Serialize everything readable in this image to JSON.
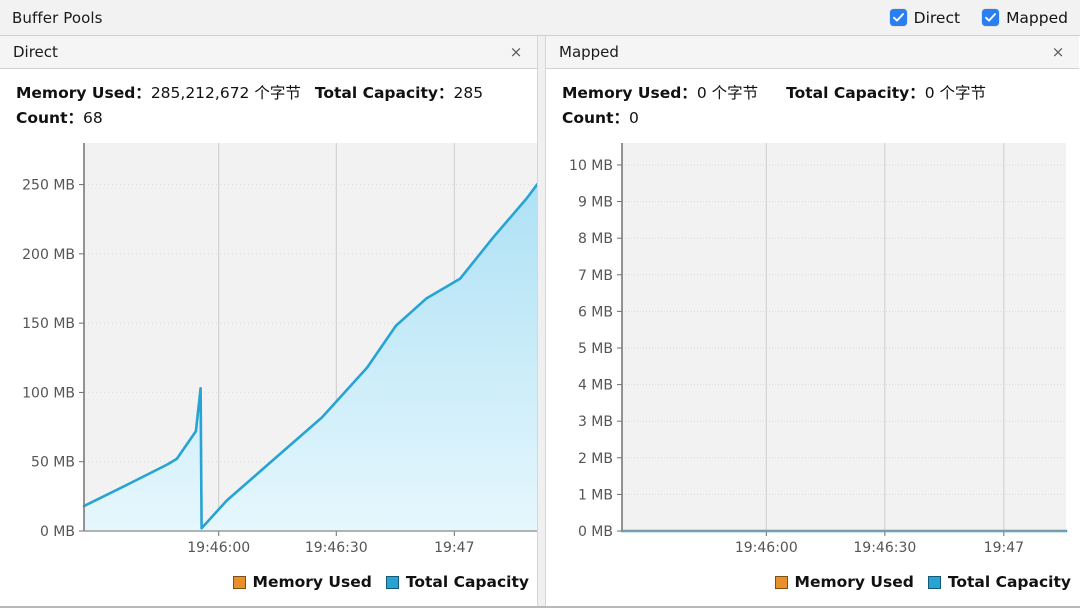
{
  "titlebar": {
    "label": "Buffer Pools",
    "checkboxes": [
      {
        "label": "Direct",
        "checked": true,
        "icon": "check-icon"
      },
      {
        "label": "Mapped",
        "checked": true,
        "icon": "check-icon"
      }
    ]
  },
  "colors": {
    "accent_blue": "#2a7ff0",
    "series_total_capacity": "#27a3d4",
    "series_memory_used": "#e8912a",
    "plot_bg": "#f2f2f2",
    "grid": "#d8d8d8",
    "axis": "#6d6d6d",
    "area_fill_top": "#a9dff4",
    "area_fill_bottom": "#e6f7fd"
  },
  "panels": [
    {
      "id": "direct",
      "title": "Direct",
      "close_label": "×",
      "stats": {
        "memory_used_label": "Memory Used：",
        "memory_used_value": "285,212,672 个字节",
        "total_capacity_label": "Total Capacity：",
        "total_capacity_value": "285",
        "count_label": "Count：",
        "count_value": "68"
      },
      "legend": [
        {
          "label": "Memory Used",
          "color": "#e8912a"
        },
        {
          "label": "Total Capacity",
          "color": "#27a3d4"
        }
      ],
      "chart_data": {
        "type": "area",
        "title": "Direct",
        "xlabel": "",
        "ylabel": "",
        "grid": true,
        "legend_position": "bottom-right",
        "x_ticks": [
          "19:46:00",
          "19:46:30",
          "19:47"
        ],
        "y_ticks": [
          "0 MB",
          "50 MB",
          "100 MB",
          "150 MB",
          "200 MB",
          "250 MB"
        ],
        "ylim": [
          0,
          280
        ],
        "y_tick_values": [
          0,
          50,
          100,
          150,
          200,
          250
        ],
        "series": [
          {
            "name": "Total Capacity",
            "color": "#27a3d4",
            "unit": "MB",
            "points": [
              {
                "t": 0.0,
                "v": 18
              },
              {
                "t": 0.1,
                "v": 35
              },
              {
                "t": 0.175,
                "v": 48
              },
              {
                "t": 0.195,
                "v": 52
              },
              {
                "t": 0.235,
                "v": 72
              },
              {
                "t": 0.245,
                "v": 103
              },
              {
                "t": 0.247,
                "v": 2
              },
              {
                "t": 0.3,
                "v": 22
              },
              {
                "t": 0.4,
                "v": 52
              },
              {
                "t": 0.5,
                "v": 82
              },
              {
                "t": 0.595,
                "v": 118
              },
              {
                "t": 0.655,
                "v": 148
              },
              {
                "t": 0.72,
                "v": 168
              },
              {
                "t": 0.79,
                "v": 182
              },
              {
                "t": 0.86,
                "v": 212
              },
              {
                "t": 0.93,
                "v": 240
              },
              {
                "t": 1.0,
                "v": 272
              }
            ]
          },
          {
            "name": "Memory Used",
            "color": "#e8912a",
            "unit": "MB",
            "points": []
          }
        ]
      }
    },
    {
      "id": "mapped",
      "title": "Mapped",
      "close_label": "×",
      "stats": {
        "memory_used_label": "Memory Used：",
        "memory_used_value": "0 个字节",
        "total_capacity_label": "Total Capacity：",
        "total_capacity_value": "0 个字节",
        "count_label": "Count：",
        "count_value": "0"
      },
      "legend": [
        {
          "label": "Memory Used",
          "color": "#e8912a"
        },
        {
          "label": "Total Capacity",
          "color": "#27a3d4"
        }
      ],
      "chart_data": {
        "type": "area",
        "title": "Mapped",
        "xlabel": "",
        "ylabel": "",
        "grid": true,
        "legend_position": "bottom-right",
        "x_ticks": [
          "19:46:00",
          "19:46:30",
          "19:47"
        ],
        "y_ticks": [
          "0 MB",
          "1 MB",
          "2 MB",
          "3 MB",
          "4 MB",
          "5 MB",
          "6 MB",
          "7 MB",
          "8 MB",
          "9 MB",
          "10 MB"
        ],
        "ylim": [
          0,
          10.6
        ],
        "y_tick_values": [
          0,
          1,
          2,
          3,
          4,
          5,
          6,
          7,
          8,
          9,
          10
        ],
        "series": [
          {
            "name": "Total Capacity",
            "color": "#27a3d4",
            "unit": "MB",
            "points": [
              {
                "t": 0.0,
                "v": 0
              },
              {
                "t": 1.0,
                "v": 0
              }
            ]
          },
          {
            "name": "Memory Used",
            "color": "#e8912a",
            "unit": "MB",
            "points": []
          }
        ]
      }
    }
  ]
}
